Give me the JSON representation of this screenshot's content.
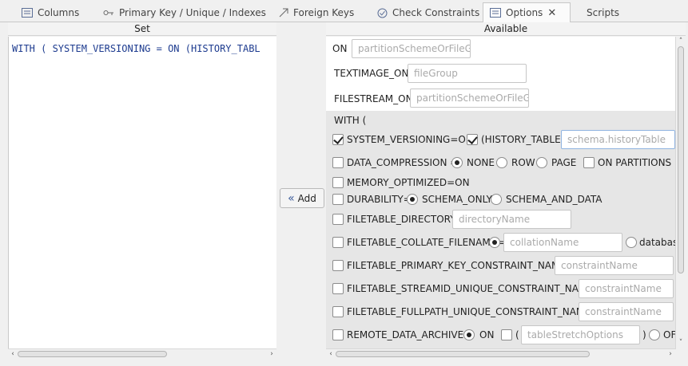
{
  "tabs": [
    {
      "label": "Columns",
      "icon": "columns-icon"
    },
    {
      "label": "Primary Key / Unique / Indexes",
      "icon": "key-icon"
    },
    {
      "label": "Foreign Keys",
      "icon": "foreign-key-arrow-icon"
    },
    {
      "label": "Check Constraints",
      "icon": "check-circle-icon"
    },
    {
      "label": "Options",
      "icon": "options-icon",
      "active": true
    },
    {
      "label": "Scripts"
    }
  ],
  "set_panel": {
    "header": "Set",
    "text": "WITH ( SYSTEM_VERSIONING = ON (HISTORY_TABL"
  },
  "add_button": {
    "label": "Add",
    "icon": "double-chevron-left-icon"
  },
  "available_panel": {
    "header": "Available",
    "on": {
      "label": "ON",
      "placeholder": "partitionSchemeOrFileGro"
    },
    "textimage_on": {
      "label": "TEXTIMAGE_ON",
      "placeholder": "fileGroup"
    },
    "filestream_on": {
      "label": "FILESTREAM_ON",
      "placeholder": "partitionSchemeOrFileGro"
    },
    "with_label": "WITH (",
    "system_versioning": {
      "label": "SYSTEM_VERSIONING=ON",
      "checked": true,
      "history_label": "(HISTORY_TABLE=",
      "history_checked": true,
      "history_value": "schema.historyTable"
    },
    "data_compression": {
      "label": "DATA_COMPRESSION =",
      "options": [
        "NONE",
        "ROW",
        "PAGE"
      ],
      "selected": "NONE",
      "partitions_label": "ON PARTITIONS ("
    },
    "memory_optimized": {
      "label": "MEMORY_OPTIMIZED=ON"
    },
    "durability": {
      "label": "DURABILITY=",
      "options": [
        "SCHEMA_ONLY",
        "SCHEMA_AND_DATA"
      ],
      "selected": "SCHEMA_ONLY"
    },
    "filetable_directory": {
      "label": "FILETABLE_DIRECTORY=",
      "placeholder": "directoryName"
    },
    "filetable_collate": {
      "label": "FILETABLE_COLLATE_FILENAME=",
      "placeholder": "collationName",
      "alt_option": "databas"
    },
    "filetable_pk": {
      "label": "FILETABLE_PRIMARY_KEY_CONSTRAINT_NAME=",
      "placeholder": "constraintName"
    },
    "filetable_streamid": {
      "label": "FILETABLE_STREAMID_UNIQUE_CONSTRAINT_NAME=",
      "placeholder": "constraintName"
    },
    "filetable_fullpath": {
      "label": "FILETABLE_FULLPATH_UNIQUE_CONSTRAINT_NAME=",
      "placeholder": "constraintName"
    },
    "remote_data_archive": {
      "label": "REMOTE_DATA_ARCHIVE=",
      "on_label": "ON",
      "paren_open": "(",
      "placeholder": "tableStretchOptions",
      "paren_close": ")",
      "off_label": "OF"
    }
  }
}
